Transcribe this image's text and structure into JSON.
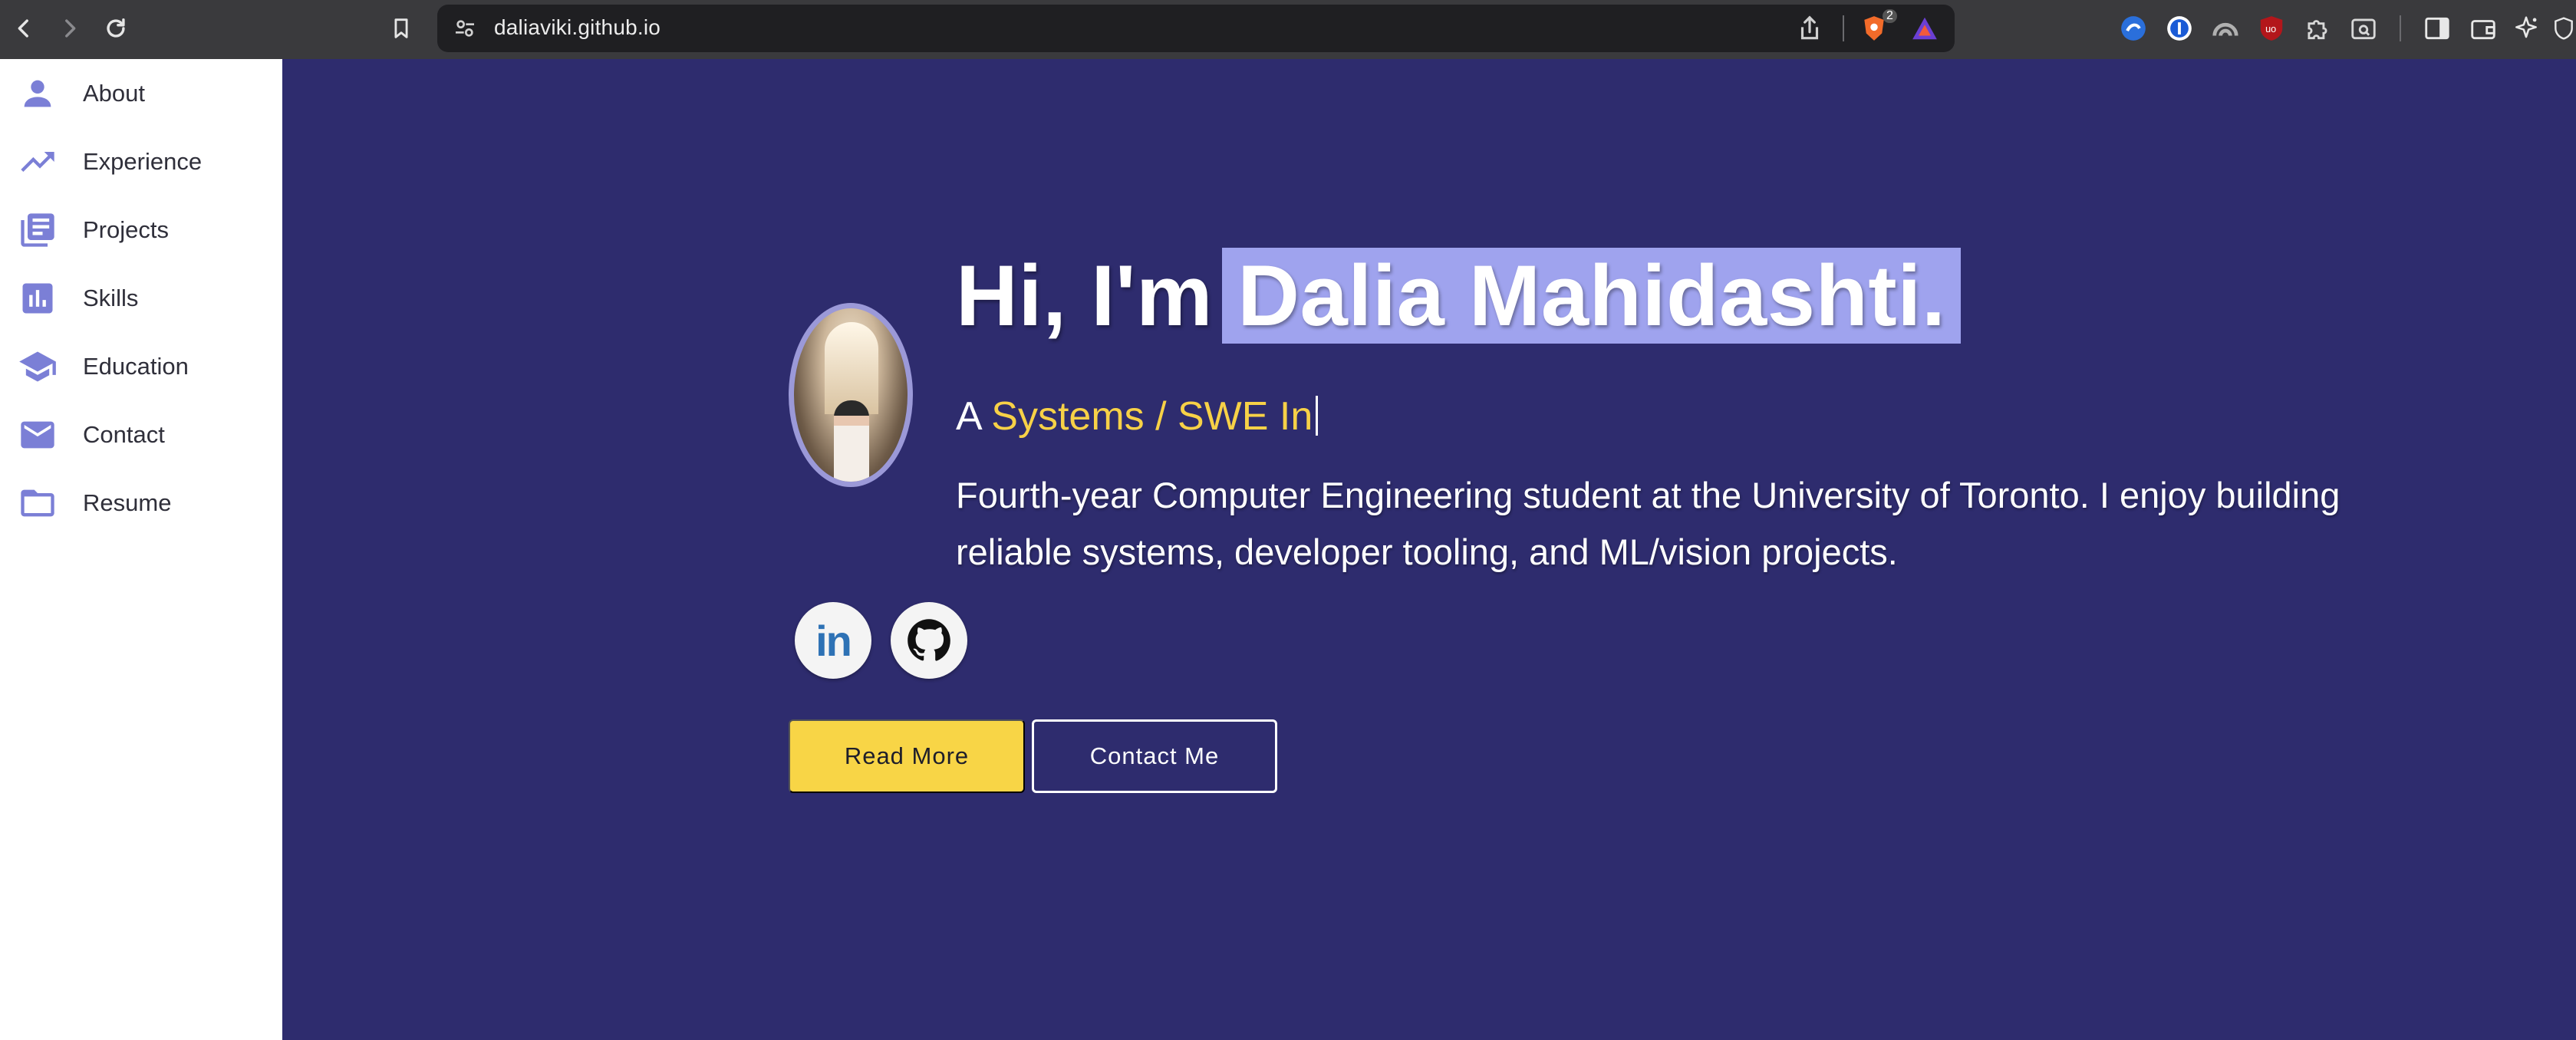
{
  "browser": {
    "url": "daliaviki.github.io",
    "shield_badge": "2"
  },
  "sidebar": {
    "items": [
      {
        "label": "About",
        "icon": "person-icon"
      },
      {
        "label": "Experience",
        "icon": "trending-up-icon"
      },
      {
        "label": "Projects",
        "icon": "library-books-icon"
      },
      {
        "label": "Skills",
        "icon": "bar-chart-icon"
      },
      {
        "label": "Education",
        "icon": "school-icon"
      },
      {
        "label": "Contact",
        "icon": "mail-icon"
      },
      {
        "label": "Resume",
        "icon": "folder-icon"
      }
    ]
  },
  "hero": {
    "greeting": "Hi, I'm",
    "name": "Dalia Mahidashti.",
    "tagline_prefix": "A",
    "tagline_role": "Systems / SWE In",
    "bio": "Fourth-year Computer Engineering student at the University of Toronto. I enjoy building reliable systems, developer tooling, and ML/vision projects.",
    "linkedin_glyph": "in",
    "buttons": {
      "read_more": "Read More",
      "contact": "Contact Me"
    }
  },
  "colors": {
    "hero_bg": "#2e2c6e",
    "accent_yellow": "#f8d546",
    "accent_purple": "#7b7fd6",
    "name_highlight": "#9fa3ee"
  }
}
